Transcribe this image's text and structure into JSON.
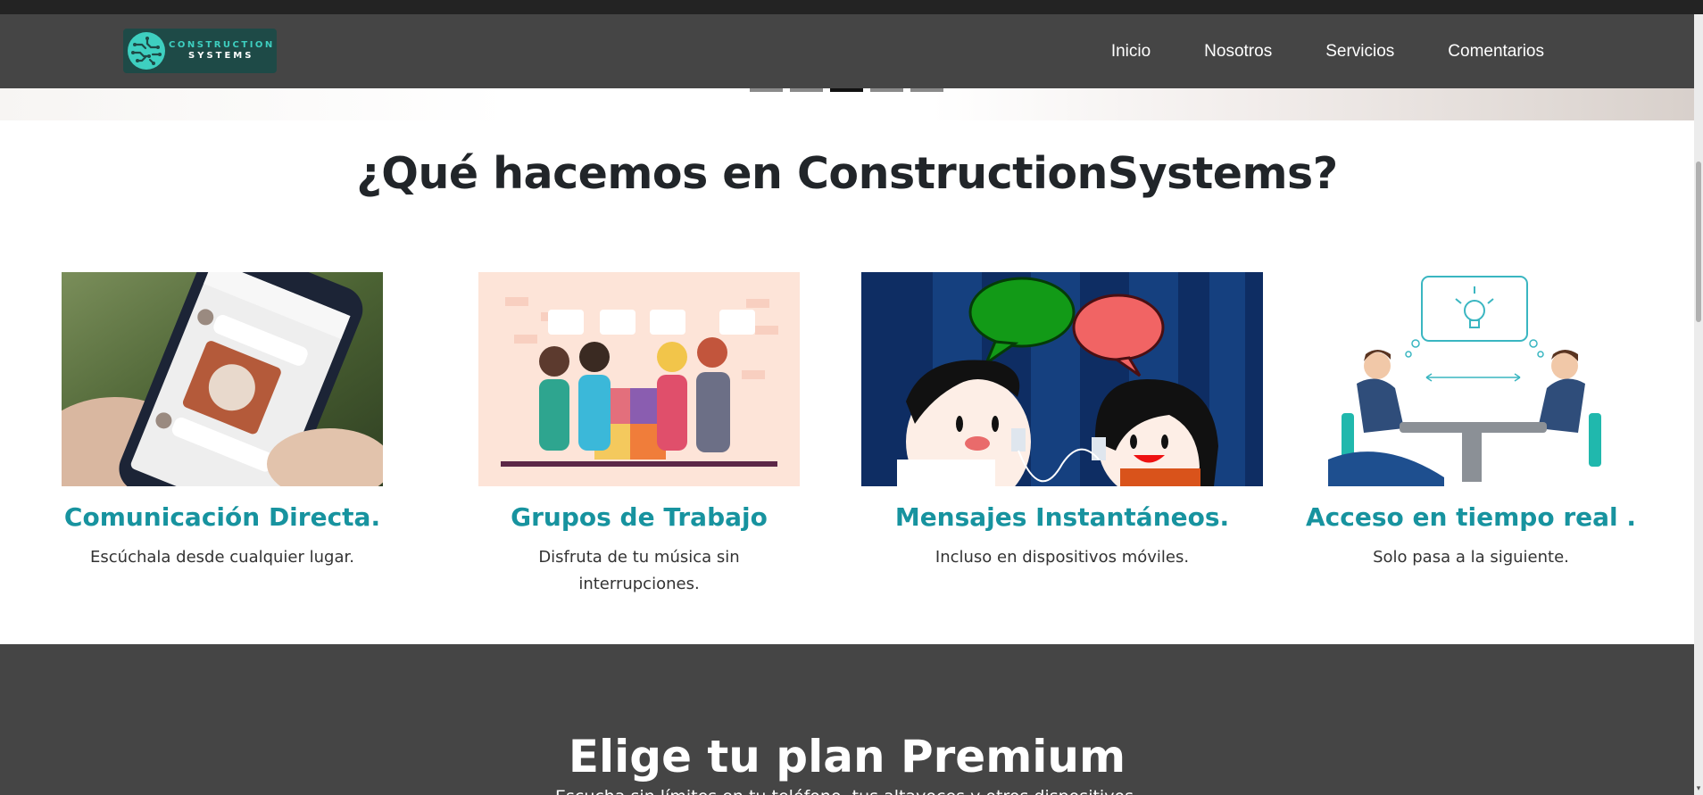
{
  "brand": {
    "logo_line1": "CONSTRUCTION",
    "logo_line2": "SYSTEMS",
    "accent": "#17939f",
    "nav_background": "#454545"
  },
  "nav": {
    "items": [
      {
        "label": "Inicio"
      },
      {
        "label": "Nosotros"
      },
      {
        "label": "Servicios"
      },
      {
        "label": "Comentarios"
      }
    ]
  },
  "carousel": {
    "slide_count": 5,
    "active_index": 3
  },
  "features_section": {
    "title": "¿Qué hacemos en ConstructionSystems?",
    "items": [
      {
        "title": "Comunicación Directa.",
        "description": "Escúchala desde cualquier lugar.",
        "image": "phone-chat-photo"
      },
      {
        "title": "Grupos de Trabajo",
        "description": "Disfruta de tu música sin interrupciones.",
        "image": "team-puzzle-illustration"
      },
      {
        "title": "Mensajes Instantáneos.",
        "description": "Incluso en dispositivos móviles.",
        "image": "kids-tin-can-phone-illustration"
      },
      {
        "title": "Acceso en tiempo real .",
        "description": "Solo pasa a la siguiente.",
        "image": "meeting-idea-illustration"
      }
    ]
  },
  "premium_section": {
    "title": "Elige tu plan Premium",
    "subtitle": "Escucha sin límites en tu teléfono, tus altavoces y otros dispositivos."
  }
}
